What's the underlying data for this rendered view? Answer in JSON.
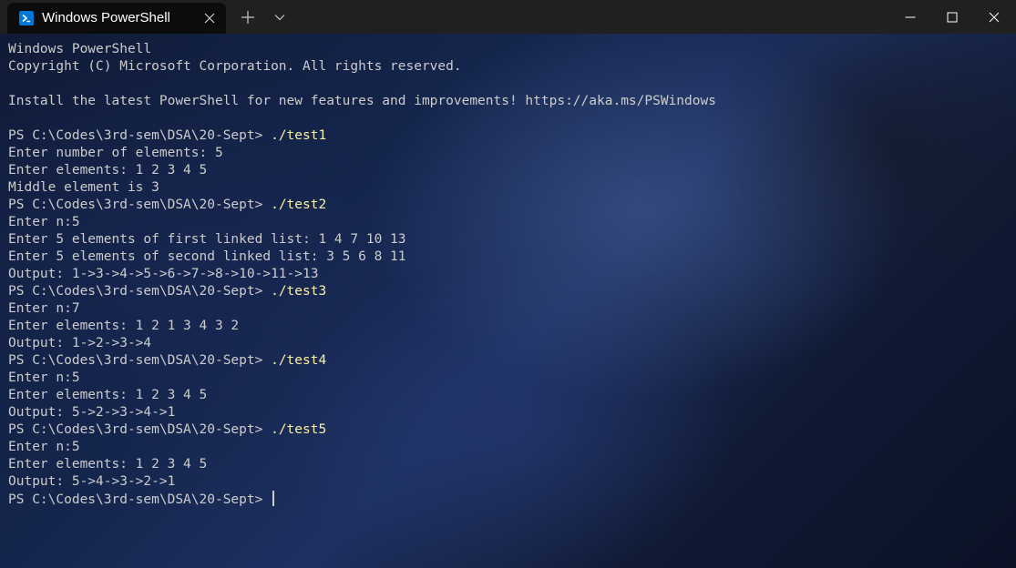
{
  "tab": {
    "title": "Windows PowerShell",
    "icon": "powershell-icon",
    "accent": "#0078d4"
  },
  "window_controls": [
    "minimize-icon",
    "maximize-icon",
    "close-icon"
  ],
  "terminal": {
    "prompt": "PS C:\\Codes\\3rd-sem\\DSA\\20-Sept> ",
    "header": [
      "Windows PowerShell",
      "Copyright (C) Microsoft Corporation. All rights reserved.",
      "",
      "Install the latest PowerShell for new features and improvements! https://aka.ms/PSWindows",
      ""
    ],
    "sessions": [
      {
        "command": "./test1",
        "output": [
          "Enter number of elements: 5",
          "Enter elements: 1 2 3 4 5",
          "Middle element is 3"
        ]
      },
      {
        "command": "./test2",
        "output": [
          "Enter n:5",
          "Enter 5 elements of first linked list: 1 4 7 10 13",
          "Enter 5 elements of second linked list: 3 5 6 8 11",
          "Output: 1->3->4->5->6->7->8->10->11->13"
        ]
      },
      {
        "command": "./test3",
        "output": [
          "Enter n:7",
          "Enter elements: 1 2 1 3 4 3 2",
          "Output: 1->2->3->4"
        ]
      },
      {
        "command": "./test4",
        "output": [
          "Enter n:5",
          "Enter elements: 1 2 3 4 5",
          "Output: 5->2->3->4->1"
        ]
      },
      {
        "command": "./test5",
        "output": [
          "Enter n:5",
          "Enter elements: 1 2 3 4 5",
          "Output: 5->4->3->2->1"
        ]
      }
    ],
    "colors": {
      "text": "#cccccc",
      "command": "#f9f1a5"
    }
  }
}
